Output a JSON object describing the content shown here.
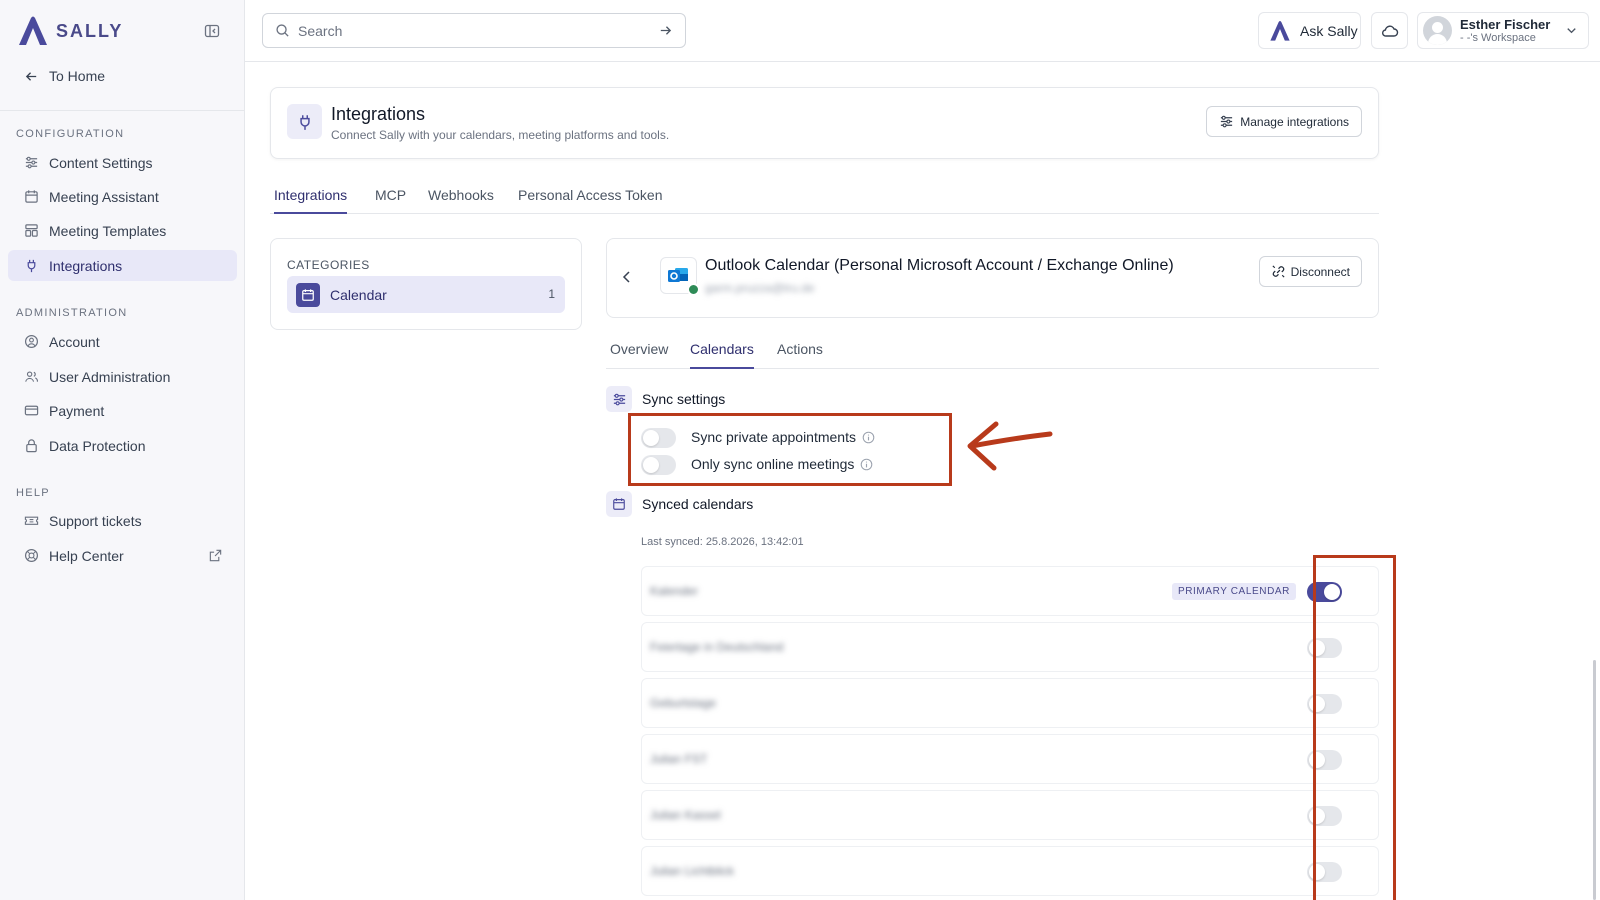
{
  "brand": {
    "name": "SALLY"
  },
  "sidebar": {
    "to_home": "To Home",
    "sections": {
      "configuration": "CONFIGURATION",
      "administration": "ADMINISTRATION",
      "help": "HELP"
    },
    "config_items": [
      "Content Settings",
      "Meeting Assistant",
      "Meeting Templates",
      "Integrations"
    ],
    "admin_items": [
      "Account",
      "User Administration",
      "Payment",
      "Data Protection"
    ],
    "help_items": [
      "Support tickets",
      "Help Center"
    ]
  },
  "topbar": {
    "search_placeholder": "Search",
    "ask_label": "Ask Sally",
    "user_name": "Esther Fischer",
    "user_workspace": "- -'s Workspace"
  },
  "header": {
    "title": "Integrations",
    "subtitle": "Connect Sally with your calendars, meeting platforms and tools.",
    "manage_label": "Manage integrations"
  },
  "tabs": [
    "Integrations",
    "MCP",
    "Webhooks",
    "Personal Access Token"
  ],
  "categories": {
    "label": "CATEGORIES",
    "items": [
      {
        "name": "Calendar",
        "count": "1"
      }
    ]
  },
  "integration": {
    "title": "Outlook Calendar (Personal Microsoft Account / Exchange Online)",
    "account_email": "garm.pruzza@tru.de",
    "disconnect_label": "Disconnect",
    "subtabs": [
      "Overview",
      "Calendars",
      "Actions"
    ]
  },
  "sync_settings": {
    "title": "Sync settings",
    "options": [
      {
        "label": "Sync private appointments",
        "enabled": false
      },
      {
        "label": "Only sync online meetings",
        "enabled": false
      }
    ]
  },
  "synced_calendars": {
    "title": "Synced calendars",
    "last_synced": "Last synced: 25.8.2026, 13:42:01",
    "primary_badge": "PRIMARY CALENDAR",
    "items": [
      {
        "name": "Kalender",
        "enabled": true,
        "primary": true
      },
      {
        "name": "Feiertage in Deutschland",
        "enabled": false,
        "primary": false
      },
      {
        "name": "Geburtstage",
        "enabled": false,
        "primary": false
      },
      {
        "name": "Julian FST",
        "enabled": false,
        "primary": false
      },
      {
        "name": "Julian Kassel",
        "enabled": false,
        "primary": false
      },
      {
        "name": "Julian Lichtblick",
        "enabled": false,
        "primary": false
      }
    ]
  },
  "colors": {
    "accent": "#4a4a9c",
    "annotation": "#b83a1b"
  }
}
